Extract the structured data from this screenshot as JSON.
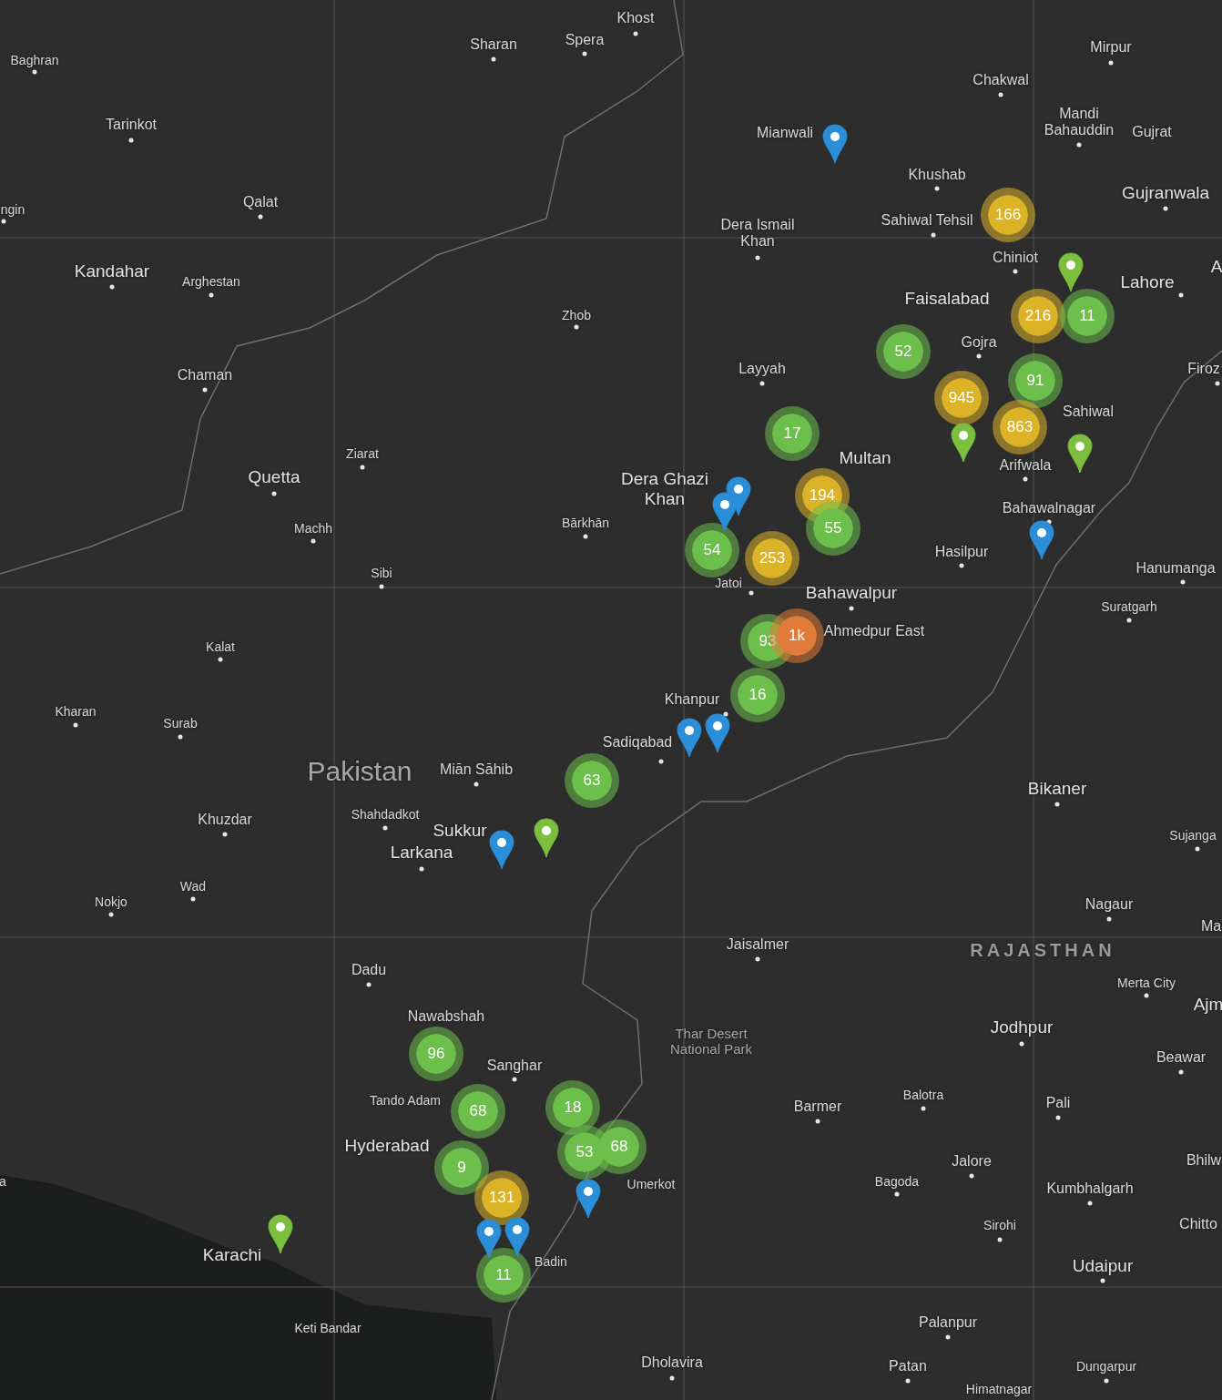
{
  "map": {
    "places": [
      {
        "name": "Khost",
        "kind": "town"
      },
      {
        "name": "Baghran",
        "kind": "small"
      },
      {
        "name": "Sharan",
        "kind": "town"
      },
      {
        "name": "Spera",
        "kind": "town"
      },
      {
        "name": "Mirpur",
        "kind": "town"
      },
      {
        "name": "Chakwal",
        "kind": "town"
      },
      {
        "name": "Tarinkot",
        "kind": "town"
      },
      {
        "name": "Mianwali",
        "kind": "town"
      },
      {
        "name": "Mandi Bahauddin",
        "kind": "town"
      },
      {
        "name": "Gujrat",
        "kind": "town"
      },
      {
        "name": "Khushab",
        "kind": "town"
      },
      {
        "name": "ngin",
        "kind": "small"
      },
      {
        "name": "Qalat",
        "kind": "town"
      },
      {
        "name": "Dera Ismail Khan",
        "kind": "town"
      },
      {
        "name": "Sahiwal Tehsil",
        "kind": "town"
      },
      {
        "name": "Gujranwala",
        "kind": "major"
      },
      {
        "name": "Kandahar",
        "kind": "major"
      },
      {
        "name": "Arghestan",
        "kind": "small"
      },
      {
        "name": "Chiniot",
        "kind": "town"
      },
      {
        "name": "Faisalabad",
        "kind": "major"
      },
      {
        "name": "Lahore",
        "kind": "major"
      },
      {
        "name": "A",
        "kind": "major"
      },
      {
        "name": "Zhob",
        "kind": "small"
      },
      {
        "name": "Gojra",
        "kind": "town"
      },
      {
        "name": "Chaman",
        "kind": "town"
      },
      {
        "name": "Layyah",
        "kind": "town"
      },
      {
        "name": "Firoz",
        "kind": "town"
      },
      {
        "name": "Sahiwal",
        "kind": "town"
      },
      {
        "name": "Ziarat",
        "kind": "small"
      },
      {
        "name": "Quetta",
        "kind": "major"
      },
      {
        "name": "Dera Ghazi Khan",
        "kind": "major"
      },
      {
        "name": "Multan",
        "kind": "major"
      },
      {
        "name": "Arifwala",
        "kind": "town"
      },
      {
        "name": "Machh",
        "kind": "small"
      },
      {
        "name": "Bārkhān",
        "kind": "small"
      },
      {
        "name": "Bahawalnagar",
        "kind": "town"
      },
      {
        "name": "Sibi",
        "kind": "small"
      },
      {
        "name": "Jatoi",
        "kind": "small"
      },
      {
        "name": "Bahawalpur",
        "kind": "major"
      },
      {
        "name": "Hasilpur",
        "kind": "town"
      },
      {
        "name": "Suratgarh",
        "kind": "small"
      },
      {
        "name": "Hanumanga",
        "kind": "town"
      },
      {
        "name": "Kalat",
        "kind": "small"
      },
      {
        "name": "Ahmedpur East",
        "kind": "town"
      },
      {
        "name": "Kharan",
        "kind": "small"
      },
      {
        "name": "Surab",
        "kind": "small"
      },
      {
        "name": "Khanpur",
        "kind": "town"
      },
      {
        "name": "Sadiqabad",
        "kind": "town"
      },
      {
        "name": "Pakistan",
        "kind": "country"
      },
      {
        "name": "Miān Sāhib",
        "kind": "town"
      },
      {
        "name": "Bikaner",
        "kind": "major"
      },
      {
        "name": "Khuzdar",
        "kind": "town"
      },
      {
        "name": "Shahdadkot",
        "kind": "small"
      },
      {
        "name": "Sukkur",
        "kind": "major"
      },
      {
        "name": "Larkana",
        "kind": "major"
      },
      {
        "name": "Sujanga",
        "kind": "small"
      },
      {
        "name": "Wad",
        "kind": "small"
      },
      {
        "name": "Nokjo",
        "kind": "small"
      },
      {
        "name": "Nagaur",
        "kind": "town"
      },
      {
        "name": "Ma",
        "kind": "town"
      },
      {
        "name": "Jaisalmer",
        "kind": "town"
      },
      {
        "name": "Dadu",
        "kind": "town"
      },
      {
        "name": "RAJASTHAN",
        "kind": "region"
      },
      {
        "name": "Merta City",
        "kind": "small"
      },
      {
        "name": "Nawabshah",
        "kind": "town"
      },
      {
        "name": "Thar Desert National Park",
        "kind": "park"
      },
      {
        "name": "Jodhpur",
        "kind": "major"
      },
      {
        "name": "Ajm",
        "kind": "major"
      },
      {
        "name": "Sanghar",
        "kind": "town"
      },
      {
        "name": "Beawar",
        "kind": "town"
      },
      {
        "name": "Tando Adam",
        "kind": "small"
      },
      {
        "name": "Barmer",
        "kind": "town"
      },
      {
        "name": "Balotra",
        "kind": "small"
      },
      {
        "name": "Pali",
        "kind": "town"
      },
      {
        "name": "Hyderabad",
        "kind": "major"
      },
      {
        "name": "Jalore",
        "kind": "town"
      },
      {
        "name": "Bhilw",
        "kind": "town"
      },
      {
        "name": "a",
        "kind": "small"
      },
      {
        "name": "Umerkot",
        "kind": "small"
      },
      {
        "name": "Bagoda",
        "kind": "small"
      },
      {
        "name": "Kumbhalgarh",
        "kind": "town"
      },
      {
        "name": "Sirohi",
        "kind": "small"
      },
      {
        "name": "Chitto",
        "kind": "town"
      },
      {
        "name": "Karachi",
        "kind": "major"
      },
      {
        "name": "Badin",
        "kind": "small"
      },
      {
        "name": "Udaipur",
        "kind": "major"
      },
      {
        "name": "Keti Bandar",
        "kind": "small"
      },
      {
        "name": "Palanpur",
        "kind": "town"
      },
      {
        "name": "Dholavira",
        "kind": "town"
      },
      {
        "name": "Patan",
        "kind": "town"
      },
      {
        "name": "Dungarpur",
        "kind": "small"
      },
      {
        "name": "Himatnagar",
        "kind": "small"
      }
    ],
    "clusters": [
      {
        "count": "166",
        "color": "#dcb327"
      },
      {
        "count": "52",
        "color": "#6cbf4a"
      },
      {
        "count": "216",
        "color": "#dcb327"
      },
      {
        "count": "11",
        "color": "#6cbf4a"
      },
      {
        "count": "17",
        "color": "#6cbf4a"
      },
      {
        "count": "945",
        "color": "#dcb327"
      },
      {
        "count": "91",
        "color": "#6cbf4a"
      },
      {
        "count": "863",
        "color": "#dcb327"
      },
      {
        "count": "54",
        "color": "#6cbf4a"
      },
      {
        "count": "194",
        "color": "#dcb327"
      },
      {
        "count": "253",
        "color": "#dcb327"
      },
      {
        "count": "55",
        "color": "#6cbf4a"
      },
      {
        "count": "93",
        "color": "#6cbf4a"
      },
      {
        "count": "1k",
        "color": "#e07b39"
      },
      {
        "count": "16",
        "color": "#6cbf4a"
      },
      {
        "count": "63",
        "color": "#6cbf4a"
      },
      {
        "count": "96",
        "color": "#6cbf4a"
      },
      {
        "count": "68",
        "color": "#6cbf4a"
      },
      {
        "count": "18",
        "color": "#6cbf4a"
      },
      {
        "count": "9",
        "color": "#6cbf4a"
      },
      {
        "count": "53",
        "color": "#6cbf4a"
      },
      {
        "count": "68",
        "color": "#6cbf4a"
      },
      {
        "count": "131",
        "color": "#dcb327"
      },
      {
        "count": "11",
        "color": "#6cbf4a"
      }
    ],
    "pins": [
      {
        "color": "#2a8fd8"
      },
      {
        "color": "#7cbf3f"
      },
      {
        "color": "#7cbf3f"
      },
      {
        "color": "#7cbf3f"
      },
      {
        "color": "#2a8fd8"
      },
      {
        "color": "#2a8fd8"
      },
      {
        "color": "#2a8fd8"
      },
      {
        "color": "#2a8fd8"
      },
      {
        "color": "#2a8fd8"
      },
      {
        "color": "#2a8fd8"
      },
      {
        "color": "#7cbf3f"
      },
      {
        "color": "#7cbf3f"
      },
      {
        "color": "#2a8fd8"
      },
      {
        "color": "#2a8fd8"
      },
      {
        "color": "#2a8fd8"
      }
    ]
  }
}
